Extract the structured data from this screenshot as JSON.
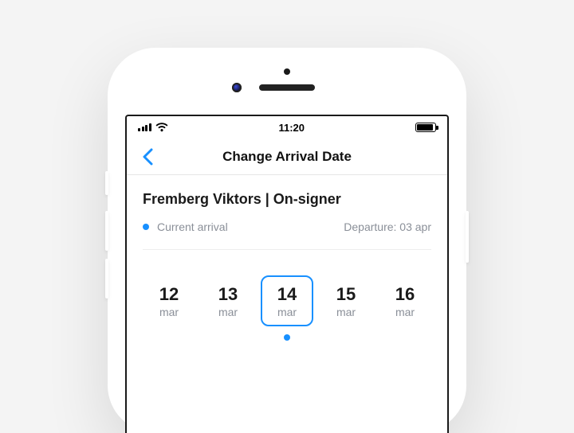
{
  "colors": {
    "accent": "#1890ff",
    "text_muted": "#8a8f98",
    "text_primary": "#1a1a1a",
    "divider": "#ededed"
  },
  "status": {
    "time": "11:20",
    "signal_icon": "signal-4-bars",
    "wifi_icon": "wifi-full",
    "battery_icon": "battery-full"
  },
  "nav": {
    "back_icon": "chevron-left",
    "title": "Change Arrival Date"
  },
  "person": {
    "name": "Fremberg Viktors",
    "role": "On-signer",
    "display": "Fremberg Viktors | On-signer"
  },
  "legend": {
    "current_label": "Current arrival",
    "departure_label": "Departure: 03 apr",
    "departure_date": "03 apr"
  },
  "date_picker": {
    "selected_index": 2,
    "options": [
      {
        "day": "12",
        "month": "mar"
      },
      {
        "day": "13",
        "month": "mar"
      },
      {
        "day": "14",
        "month": "mar"
      },
      {
        "day": "15",
        "month": "mar"
      },
      {
        "day": "16",
        "month": "mar"
      }
    ]
  },
  "pagination": {
    "dots": 1,
    "active": 0
  }
}
